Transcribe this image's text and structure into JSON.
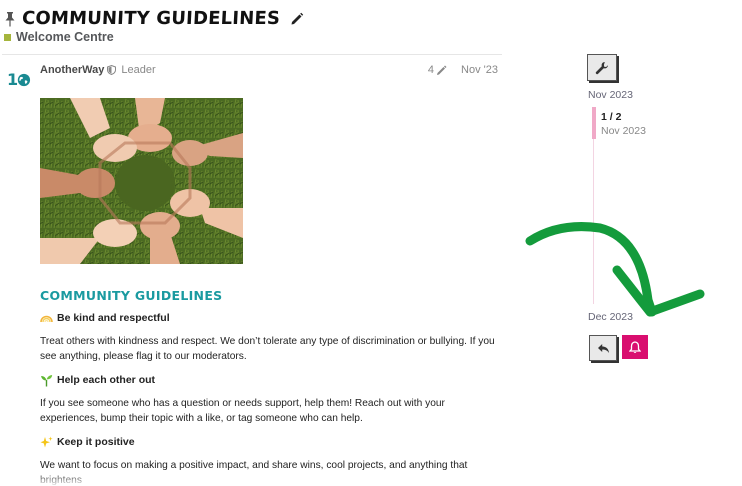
{
  "topic": {
    "title": "COMMUNITY GUIDELINES",
    "category": "Welcome Centre",
    "category_color": "#a5b53c"
  },
  "post": {
    "avatar_text": "1",
    "username": "AnotherWay",
    "user_title": "Leader",
    "edit_count": "4",
    "date": "Nov '23",
    "image_alt": "hands-linked-circle-photo",
    "heading": "COMMUNITY GUIDELINES",
    "sections": [
      {
        "icon": "rainbow-icon",
        "title": "Be kind and respectful",
        "body": "Treat others with kindness and respect. We don’t tolerate any type of discrimination or bullying. If you see anything, please flag it to our moderators."
      },
      {
        "icon": "seedling-icon",
        "title": "Help each other out",
        "body": "If you see someone who has a question or needs support, help them! Reach out with your experiences, bump their topic with a like, or tag someone who can help."
      },
      {
        "icon": "sparkles-icon",
        "title": "Keep it positive",
        "body": "We want to focus on making a positive impact, and share wins, cool projects, and anything that brightens"
      }
    ]
  },
  "timeline": {
    "start_date": "Nov 2023",
    "position": "1 / 2",
    "position_date": "Nov 2023",
    "end_date": "Dec 2023",
    "progress_fraction": 0.5
  },
  "colors": {
    "accent_pink": "#d90e6f",
    "heading_teal": "#1a9aa0",
    "annotation_green": "#149b3c"
  }
}
